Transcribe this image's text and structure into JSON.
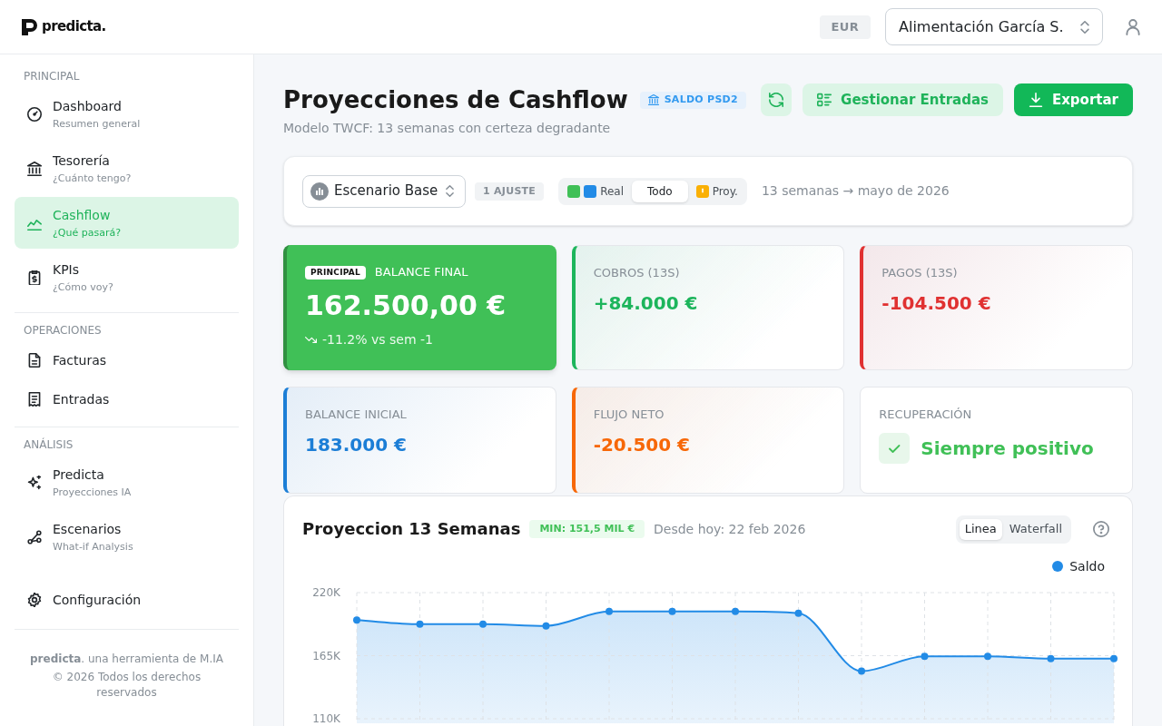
{
  "header": {
    "logo": "predicta.",
    "currency": "EUR",
    "company": "Alimentación García S."
  },
  "sidebar": {
    "sections": [
      {
        "heading": "PRINCIPAL",
        "items": [
          {
            "label": "Dashboard",
            "subtitle": "Resumen general",
            "selected": false
          },
          {
            "label": "Tesorería",
            "subtitle": "¿Cuánto tengo?",
            "selected": false
          },
          {
            "label": "Cashflow",
            "subtitle": "¿Qué pasará?",
            "selected": true
          },
          {
            "label": "KPIs",
            "subtitle": "¿Cómo voy?",
            "selected": false
          }
        ]
      },
      {
        "heading": "OPERACIONES",
        "items": [
          {
            "label": "Facturas",
            "selected": false
          },
          {
            "label": "Entradas",
            "selected": false
          }
        ]
      },
      {
        "heading": "ANÁLISIS",
        "items": [
          {
            "label": "Predicta",
            "subtitle": "Proyecciones IA",
            "selected": false
          },
          {
            "label": "Escenarios",
            "subtitle": "What-if Analysis",
            "selected": false
          }
        ]
      }
    ],
    "bottom_items": [
      {
        "label": "Configuración",
        "selected": false
      }
    ],
    "footer": {
      "credit": "**predicta**. una herramienta de M.IA",
      "copyright": "© 2026 Todos los derechos reservados"
    }
  },
  "page": {
    "title": "Proyecciones de Cashflow",
    "source_tag": "SALDO PSD2",
    "subtitle": "Modelo TWCF: 13 semanas con certeza degradante",
    "actions": [
      {
        "kind": "icon"
      },
      {
        "kind": "secondary",
        "label": "Gestionar Entradas"
      },
      {
        "kind": "primary",
        "label": "Exportar"
      }
    ]
  },
  "filters": {
    "scenario": "Escenario Base",
    "adjustments": "1 AJUSTE",
    "view_options": [
      {
        "label": "Real",
        "selected": false,
        "swatches": [
          {
            "color": "#40c057"
          },
          {
            "color": "#228be6"
          }
        ]
      },
      {
        "label": "Todo",
        "selected": true
      },
      {
        "label": "Proy.",
        "selected": false,
        "swatches": [
          {
            "color": "#fab005",
            "kind": "warning"
          }
        ]
      }
    ],
    "range": "13 semanas → mayo de 2026"
  },
  "kpis": [
    {
      "kind": "featured",
      "badge": "PRINCIPAL",
      "label": "BALANCE FINAL",
      "value": "162.500,00 €",
      "trend": "-11.2% vs sem -1",
      "color": "#40c057"
    },
    {
      "kind": "metric",
      "label": "COBROS (13S)",
      "value": "+84.000 €",
      "color": "#1db55c"
    },
    {
      "kind": "metric",
      "label": "PAGOS (13S)",
      "value": "-104.500 €",
      "color": "#e03131"
    },
    {
      "kind": "metric",
      "label": "BALANCE INICIAL",
      "value": "183.000 €",
      "color": "#1c7ed6"
    },
    {
      "kind": "metric",
      "label": "FLUJO NETO",
      "value": "-20.500 €",
      "color": "#f76707"
    },
    {
      "kind": "status",
      "label": "RECUPERACIÓN",
      "value": "Siempre positivo",
      "color": "#40c057"
    }
  ],
  "projection": {
    "title": "Proyeccion 13 Semanas",
    "min_badge": "MIN: 151,5 MIL €",
    "since": "Desde hoy: 22 feb 2026",
    "views": [
      {
        "label": "Linea",
        "selected": true
      },
      {
        "label": "Waterfall",
        "selected": false
      }
    ],
    "chart_data": {
      "type": "area",
      "grid": true,
      "series": [
        {
          "name": "Saldo",
          "color": "#228be6",
          "values": [
            196000,
            192500,
            192500,
            191000,
            203500,
            203500,
            203500,
            202000,
            151500,
            164500,
            164500,
            162500,
            162500
          ]
        }
      ],
      "ylim": [
        110000,
        220000
      ],
      "yticks": [
        {
          "value": 110000,
          "label": "110K"
        },
        {
          "value": 165000,
          "label": "165K"
        },
        {
          "value": 220000,
          "label": "220K"
        }
      ]
    }
  }
}
